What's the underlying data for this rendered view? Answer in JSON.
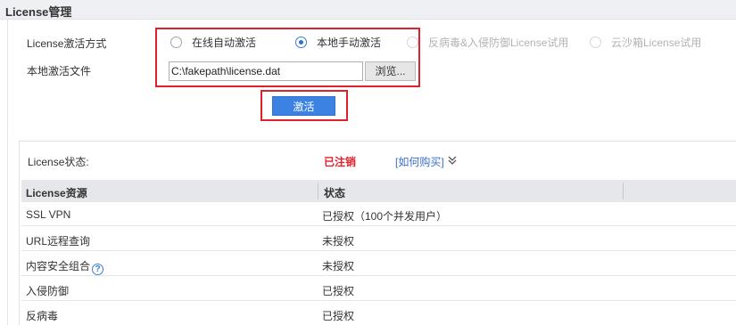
{
  "section": {
    "title": "License管理"
  },
  "activation": {
    "method_label": "License激活方式",
    "options": [
      {
        "label": "在线自动激活",
        "checked": false,
        "disabled": false
      },
      {
        "label": "本地手动激活",
        "checked": true,
        "disabled": false
      },
      {
        "label": "反病毒&入侵防御License试用",
        "checked": false,
        "disabled": true
      },
      {
        "label": "云沙箱License试用",
        "checked": false,
        "disabled": true
      }
    ],
    "file_label": "本地激活文件",
    "file_value": "C:\\fakepath\\license.dat",
    "browse_label": "浏览...",
    "activate_label": "激活"
  },
  "status": {
    "label": "License状态:",
    "value": "已注销",
    "buy_link": "[如何购买]",
    "headers": {
      "resource": "License资源",
      "state": "状态"
    },
    "rows": [
      {
        "resource": "SSL VPN",
        "state": "已授权（100个并发用户）"
      },
      {
        "resource": "URL远程查询",
        "state": "未授权"
      },
      {
        "resource": "内容安全组合",
        "state": "未授权",
        "help": "?"
      },
      {
        "resource": "入侵防御",
        "state": "已授权"
      },
      {
        "resource": "反病毒",
        "state": "已授权"
      }
    ]
  },
  "colors": {
    "accent": "#3b82e3",
    "highlight": "#e0202a",
    "link": "#3a6fc9"
  }
}
